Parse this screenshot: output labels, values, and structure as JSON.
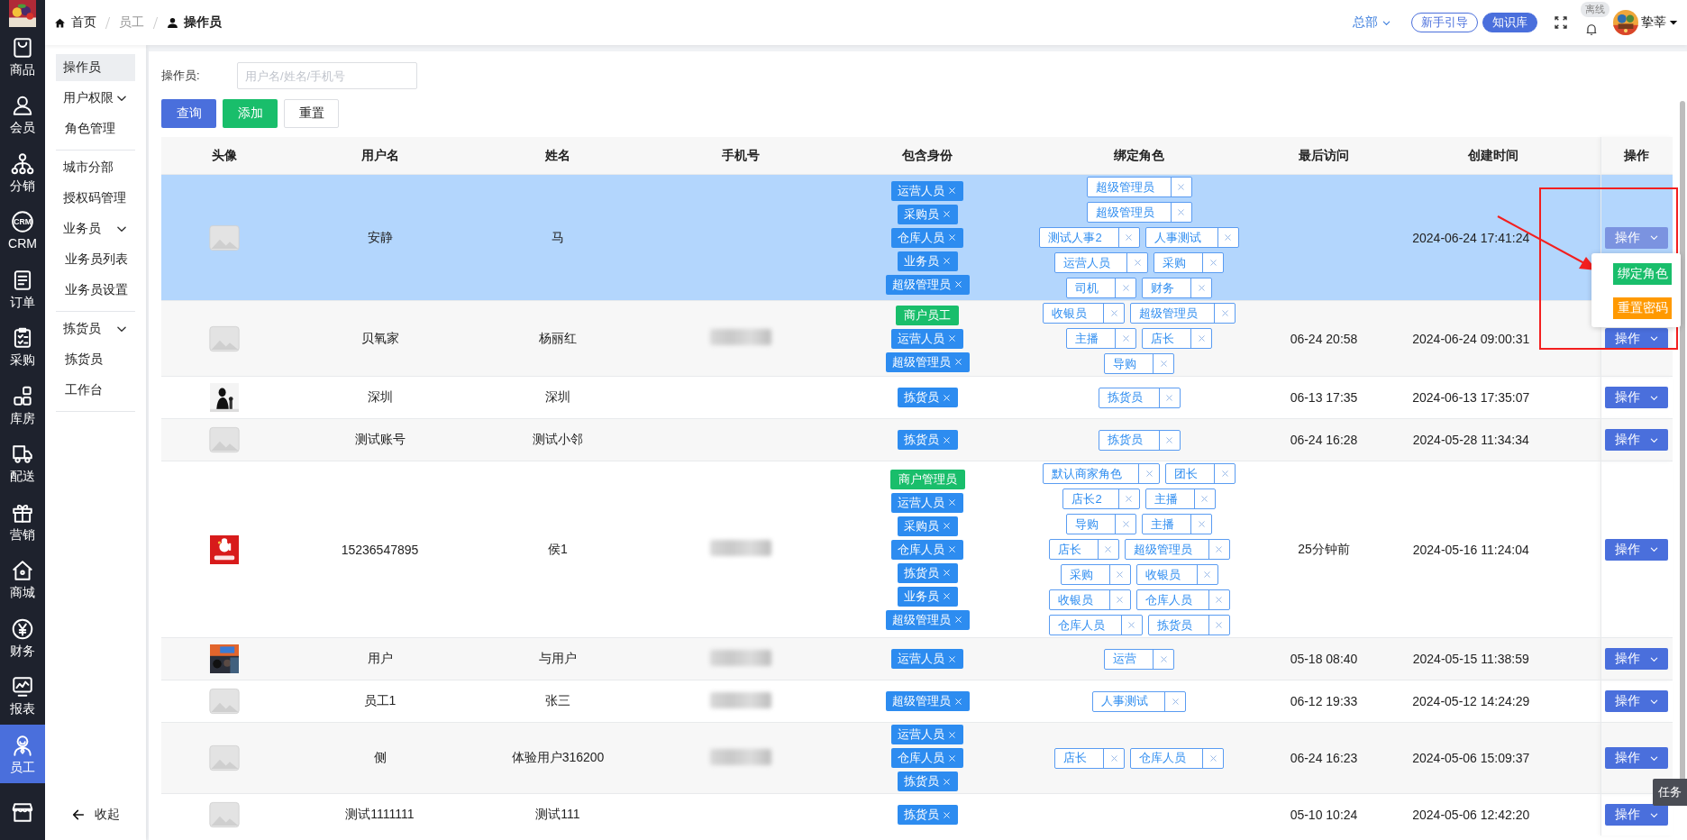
{
  "rail": {
    "items": [
      {
        "label": "商品",
        "selected": false
      },
      {
        "label": "会员",
        "selected": false
      },
      {
        "label": "分销",
        "selected": false
      },
      {
        "label": "CRM",
        "icon_text": "CRM",
        "selected": false
      },
      {
        "label": "订单",
        "selected": false
      },
      {
        "label": "采购",
        "selected": false
      },
      {
        "label": "库房",
        "selected": false
      },
      {
        "label": "配送",
        "selected": false
      },
      {
        "label": "营销",
        "selected": false
      },
      {
        "label": "商城",
        "selected": false
      },
      {
        "label": "财务",
        "selected": false
      },
      {
        "label": "报表",
        "selected": false
      },
      {
        "label": "员工",
        "selected": true
      },
      {
        "selected": false
      }
    ]
  },
  "breadcrumb": [
    {
      "label": "首页",
      "kind": "link"
    },
    {
      "label": "员工",
      "kind": "text"
    },
    {
      "label": "操作员",
      "kind": "current"
    }
  ],
  "header": {
    "org": "总部",
    "guide": "新手引导",
    "kb": "知识库",
    "status": "离线",
    "user": "挚莘"
  },
  "subnav": {
    "sections": [
      [
        {
          "label": "操作员",
          "selected": true
        },
        {
          "label": "用户权限",
          "expanded": true,
          "children": [
            {
              "label": "角色管理",
              "selected": false
            }
          ]
        }
      ],
      [
        {
          "label": "城市分部",
          "selected": false
        },
        {
          "label": "授权码管理",
          "selected": false
        },
        {
          "label": "业务员",
          "expanded": true,
          "children": [
            {
              "label": "业务员列表",
              "selected": false
            },
            {
              "label": "业务员设置",
              "selected": false
            }
          ]
        }
      ],
      [
        {
          "label": "拣货员",
          "expanded": true,
          "children": [
            {
              "label": "拣货员",
              "selected": false
            },
            {
              "label": "工作台",
              "selected": false
            }
          ]
        }
      ]
    ],
    "collapse": "收起"
  },
  "filter": {
    "label": "操作员:",
    "placeholder": "用户名/姓名/手机号",
    "buttons": [
      {
        "label": "查询",
        "kind": "primary"
      },
      {
        "label": "添加",
        "kind": "success"
      },
      {
        "label": "重置",
        "kind": "default"
      }
    ]
  },
  "table": {
    "columns": [
      "头像",
      "用户名",
      "姓名",
      "手机号",
      "包含身份",
      "绑定角色",
      "最后访问",
      "创建时间",
      "操作"
    ],
    "action_menu": [
      {
        "label": "绑定角色",
        "color": "#19be6b"
      },
      {
        "label": "重置密码",
        "color": "#ff9900"
      }
    ],
    "rows": [
      {
        "avatar": {
          "kind": "placeholder"
        },
        "username": "安静",
        "name": "马",
        "phone_blurred": false,
        "identities": [
          {
            "label": "运营人员",
            "kind": "role"
          },
          {
            "label": "采购员",
            "kind": "role"
          },
          {
            "label": "仓库人员",
            "kind": "role"
          },
          {
            "label": "业务员",
            "kind": "role"
          },
          {
            "label": "超级管理员",
            "kind": "role"
          }
        ],
        "roles": [
          [
            "超级管理员"
          ],
          [
            "超级管理员"
          ],
          [
            "测试人事2",
            "人事测试"
          ],
          [
            "运营人员",
            "采购"
          ],
          [
            "司机",
            "财务"
          ]
        ],
        "created": "2024-06-24 17:41:24",
        "action": "操作",
        "selected": true,
        "menu_open": true
      },
      {
        "avatar": {
          "kind": "placeholder"
        },
        "username": "贝氧家",
        "name": "杨丽红",
        "phone_blurred": true,
        "identities": [
          {
            "label": "商户员工",
            "kind": "merchant"
          },
          {
            "label": "运营人员",
            "kind": "role"
          },
          {
            "label": "超级管理员",
            "kind": "role"
          }
        ],
        "roles": [
          [
            "收银员",
            "超级管理员"
          ],
          [
            "主播",
            "店长"
          ],
          [
            "导购"
          ]
        ],
        "last_visit": "06-24 20:58",
        "created": "2024-06-24 09:00:31",
        "action": "操作",
        "selected": false,
        "menu_open": false
      },
      {
        "avatar": {
          "kind": "picture"
        },
        "username": "深圳",
        "name": "深圳",
        "phone_blurred": false,
        "identities": [
          {
            "label": "拣货员",
            "kind": "role"
          }
        ],
        "roles": [
          [
            "拣货员"
          ]
        ],
        "last_visit": "06-13 17:35",
        "created": "2024-06-13 17:35:07",
        "action": "操作",
        "selected": false,
        "menu_open": false
      },
      {
        "avatar": {
          "kind": "placeholder"
        },
        "username": "测试账号",
        "name": "测试小邻",
        "phone_blurred": false,
        "identities": [
          {
            "label": "拣货员",
            "kind": "role"
          }
        ],
        "roles": [
          [
            "拣货员"
          ]
        ],
        "last_visit": "06-24 16:28",
        "created": "2024-05-28 11:34:34",
        "action": "操作",
        "selected": false,
        "menu_open": false
      },
      {
        "avatar": {
          "kind": "picture"
        },
        "username": "15236547895",
        "name": "侯1",
        "phone_blurred": true,
        "identities": [
          {
            "label": "商户管理员",
            "kind": "merchant"
          },
          {
            "label": "运营人员",
            "kind": "role"
          },
          {
            "label": "采购员",
            "kind": "role"
          },
          {
            "label": "仓库人员",
            "kind": "role"
          },
          {
            "label": "拣货员",
            "kind": "role"
          },
          {
            "label": "业务员",
            "kind": "role"
          },
          {
            "label": "超级管理员",
            "kind": "role"
          }
        ],
        "roles": [
          [
            "默认商家角色",
            "团长"
          ],
          [
            "店长2",
            "主播"
          ],
          [
            "导购",
            "主播"
          ],
          [
            "店长",
            "超级管理员"
          ],
          [
            "采购",
            "收银员"
          ],
          [
            "收银员",
            "仓库人员"
          ],
          [
            "仓库人员",
            "拣货员"
          ]
        ],
        "last_visit": "25分钟前",
        "created": "2024-05-16 11:24:04",
        "action": "操作",
        "selected": false,
        "menu_open": false
      },
      {
        "avatar": {
          "kind": "picture"
        },
        "username": "用户",
        "name": "与用户",
        "phone_blurred": true,
        "identities": [
          {
            "label": "运营人员",
            "kind": "role"
          }
        ],
        "roles": [
          [
            "运营"
          ]
        ],
        "last_visit": "05-18 08:40",
        "created": "2024-05-15 11:38:59",
        "action": "操作",
        "selected": false,
        "menu_open": false
      },
      {
        "avatar": {
          "kind": "placeholder"
        },
        "username": "员工1",
        "name": "张三",
        "phone_blurred": true,
        "identities": [
          {
            "label": "超级管理员",
            "kind": "role"
          }
        ],
        "roles": [
          [
            "人事测试"
          ]
        ],
        "last_visit": "06-12 19:33",
        "created": "2024-05-12 14:24:29",
        "action": "操作",
        "selected": false,
        "menu_open": false
      },
      {
        "avatar": {
          "kind": "placeholder"
        },
        "username": "侧",
        "name": "体验用户316200",
        "phone_blurred": true,
        "identities": [
          {
            "label": "运营人员",
            "kind": "role"
          },
          {
            "label": "仓库人员",
            "kind": "role"
          },
          {
            "label": "拣货员",
            "kind": "role"
          }
        ],
        "roles": [
          [
            "店长",
            "仓库人员"
          ]
        ],
        "last_visit": "06-24 16:23",
        "created": "2024-05-06 15:09:37",
        "action": "操作",
        "selected": false,
        "menu_open": false
      },
      {
        "avatar": {
          "kind": "placeholder"
        },
        "username": "测试1111111",
        "name": "测试111",
        "phone_blurred": false,
        "identities": [
          {
            "label": "拣货员",
            "kind": "role"
          }
        ],
        "last_visit": "05-10 10:24",
        "created": "2024-05-06 12:42:20",
        "action": "操作",
        "selected": false,
        "menu_open": false
      }
    ]
  },
  "task_tab": "任务"
}
